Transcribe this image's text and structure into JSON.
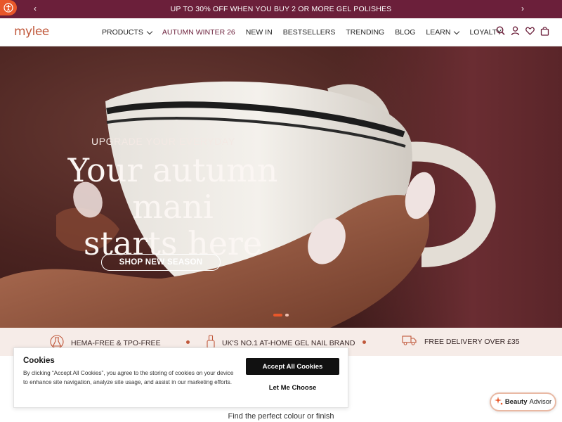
{
  "promo": {
    "text": "UP TO 30% OFF WHEN YOU BUY 2 OR MORE GEL POLISHES",
    "prev_icon": "chevron-left-icon",
    "next_icon": "chevron-right-icon",
    "accessibility_icon": "accessibility-icon"
  },
  "header": {
    "logo": "mylee",
    "nav": [
      {
        "label": "PRODUCTS",
        "dropdown": true
      },
      {
        "label": "AUTUMN WINTER 26",
        "dropdown": false
      },
      {
        "label": "NEW IN",
        "dropdown": false
      },
      {
        "label": "BESTSELLERS",
        "dropdown": false
      },
      {
        "label": "TRENDING",
        "dropdown": false
      },
      {
        "label": "BLOG",
        "dropdown": false
      },
      {
        "label": "LEARN",
        "dropdown": true
      },
      {
        "label": "LOYALTY",
        "dropdown": false
      }
    ],
    "icons": [
      "search-icon",
      "account-icon",
      "wishlist-icon",
      "bag-icon"
    ]
  },
  "hero": {
    "eyebrow": "UPGRADE YOUR EVERYDAY",
    "headline_line1": "Your autumn mani",
    "headline_line2": "starts here",
    "cta": "SHOP NEW SEASON",
    "slides": 2,
    "active_slide": 1
  },
  "usp": [
    {
      "icon": "formula-icon",
      "text": "HEMA-FREE & TPO-FREE"
    },
    {
      "icon": "nail-polish-icon",
      "text": "UK'S NO.1 AT-HOME GEL NAIL BRAND"
    },
    {
      "icon": "delivery-truck-icon",
      "text": "FREE DELIVERY OVER £35"
    }
  ],
  "cookie": {
    "title": "Cookies",
    "body": "By clicking “Accept All Cookies”, you agree to the storing of cookies on your device to enhance site navigation, analyze site usage, and assist in our marketing efforts.",
    "accept": "Accept All Cookies",
    "choose": "Let Me Choose"
  },
  "find_text": "Find the perfect colour or finish",
  "advisor": {
    "bold": "Beauty",
    "rest": "Advisor",
    "icon": "sparkle-icon"
  },
  "colors": {
    "brand": "#6b1f3a",
    "accent": "#e8572a",
    "logo": "#c0583b"
  }
}
